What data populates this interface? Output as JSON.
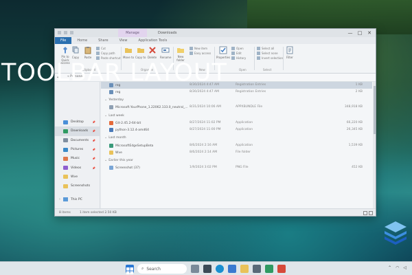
{
  "overlay": {
    "title": "TOOLBAR LAYOUT"
  },
  "window": {
    "context_tab": "Manage",
    "title": "Downloads",
    "controls": {
      "minimize": "—",
      "maximize": "□",
      "close": "✕"
    },
    "ribbon_tabs": [
      "File",
      "Home",
      "Share",
      "View",
      "Application Tools"
    ],
    "ribbon": {
      "clipboard": {
        "pin": "Pin to Quick access",
        "copy": "Copy",
        "paste": "Paste",
        "cut": "Cut",
        "copy_path": "Copy path",
        "paste_shortcut": "Paste shortcut",
        "group": "Clipboard"
      },
      "organize": {
        "move_to": "Move to",
        "copy_to": "Copy to",
        "delete": "Delete",
        "rename": "Rename",
        "group": "Organize"
      },
      "new": {
        "new_folder": "New folder",
        "new_item": "New item",
        "easy_access": "Easy access",
        "group": "New"
      },
      "open": {
        "properties": "Properties",
        "open": "Open",
        "edit": "Edit",
        "history": "History",
        "group": "Open"
      },
      "select": {
        "select_all": "Select all",
        "select_none": "Select none",
        "invert": "Invert selection",
        "group": "Select"
      },
      "filter": {
        "filter": "Filter"
      }
    },
    "address": {
      "path": "« Personal"
    },
    "nav": {
      "items": [
        {
          "label": "Desktop",
          "icon": "desktop-icon",
          "color": "#4a8fd8"
        },
        {
          "label": "Downloads",
          "icon": "downloads-icon",
          "color": "#2f9a62"
        },
        {
          "label": "Documents",
          "icon": "documents-icon",
          "color": "#7f8ea0"
        },
        {
          "label": "Pictures",
          "icon": "pictures-icon",
          "color": "#3a8ac9"
        },
        {
          "label": "Music",
          "icon": "music-icon",
          "color": "#e0794c"
        },
        {
          "label": "Videos",
          "icon": "videos-icon",
          "color": "#8f5fcf"
        },
        {
          "label": "Wve",
          "icon": "folder-icon",
          "color": "#e9c25a"
        },
        {
          "label": "Screenshots",
          "icon": "folder-icon",
          "color": "#e9c25a"
        }
      ],
      "this_pc": "This PC"
    },
    "files": {
      "groups": [
        "Yesterday",
        "Last week",
        "Last month",
        "Earlier this year"
      ],
      "rows": [
        {
          "name": "reg",
          "date": "8/30/2024 4:47 AM",
          "type": "Registration Entries",
          "size": "1 KB"
        },
        {
          "name": "reg",
          "date": "8/30/2024 4:47 AM",
          "type": "Registration Entries",
          "size": "2 KB"
        },
        {
          "name": "Microsoft.YourPhone_1.22062.133.0_neutral_...",
          "date": "8/31/2024 10:06 AM",
          "type": "APPXBUNDLE File",
          "size": "348,918 KB"
        },
        {
          "name": "Git-2.45.2-64-bit",
          "date": "8/27/2024 11:02 PM",
          "type": "Application",
          "size": "66,220 KB"
        },
        {
          "name": "python-3.12.4-amd64",
          "date": "8/27/2024 11:00 PM",
          "type": "Application",
          "size": "26,345 KB"
        },
        {
          "name": "MicrosoftEdgeSetupBeta",
          "date": "8/6/2024 2:16 AM",
          "type": "Application",
          "size": "1,539 KB"
        },
        {
          "name": "Wve",
          "date": "8/6/2024 2:14 AM",
          "type": "File folder",
          "size": ""
        },
        {
          "name": "Screenshot (37)",
          "date": "1/9/2024 3:02 PM",
          "type": "PNG File",
          "size": "452 KB"
        }
      ]
    },
    "status": {
      "items": "8 items",
      "selected": "1 item selected  2.50 KB"
    }
  },
  "taskbar": {
    "search_placeholder": "Search"
  },
  "colors": {
    "accent": "#2a6fb0",
    "selection": "#cdd6e0"
  }
}
